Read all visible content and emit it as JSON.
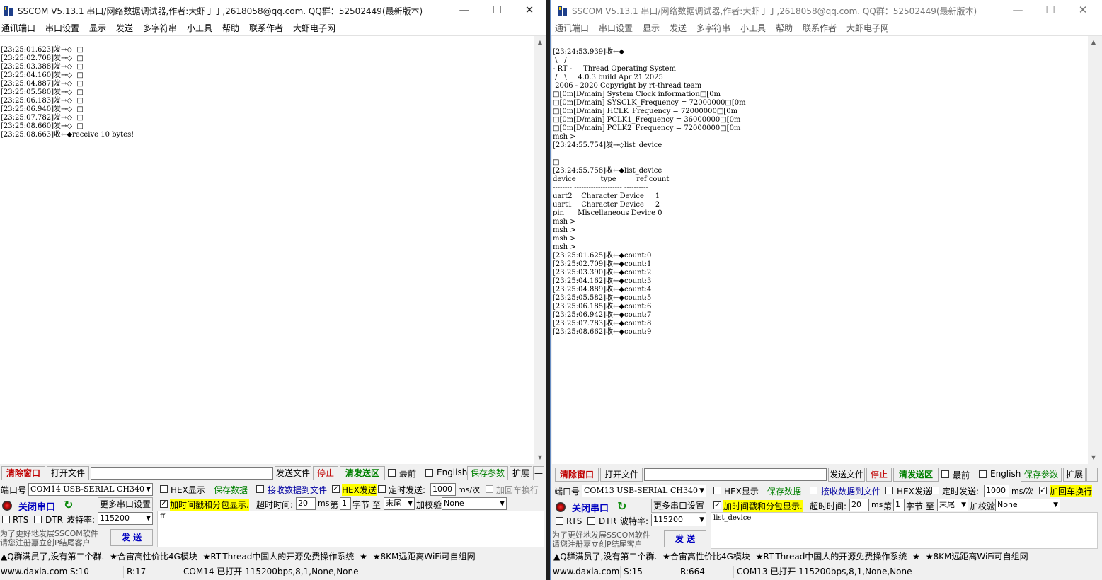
{
  "left": {
    "title": "SSCOM V5.13.1 串口/网络数据调试器,作者:大虾丁丁,2618058@qq.com. QQ群：52502449(最新版本)",
    "menu": [
      "通讯端口",
      "串口设置",
      "显示",
      "发送",
      "多字符串",
      "小工具",
      "帮助",
      "联系作者",
      "大虾电子网"
    ],
    "receive_lines": [
      "[23:25:01.623]发→◇  □",
      "[23:25:02.708]发→◇  □",
      "[23:25:03.388]发→◇  □",
      "[23:25:04.160]发→◇  □",
      "[23:25:04.887]发→◇  □",
      "[23:25:05.580]发→◇  □",
      "[23:25:06.183]发→◇  □",
      "[23:25:06.940]发→◇  □",
      "[23:25:07.782]发→◇  □",
      "[23:25:08.660]发→◇  □",
      "[23:25:08.663]收←◆receive 10 bytes!"
    ],
    "toolbar": {
      "clear": "清除窗口",
      "open_file": "打开文件",
      "file_path": "",
      "send_file": "发送文件",
      "stop": "停止",
      "clear_send": "清发送区",
      "topmost": "最前",
      "english": "English",
      "save_params": "保存参数",
      "expand": "扩展",
      "collapse": "—"
    },
    "port_label": "端口号",
    "port_value": "COM14 USB-SERIAL CH340",
    "hex_display": "HEX显示",
    "save_data": "保存数据",
    "recv_to_file": "接收数据到文件",
    "hex_send": "HEX发送",
    "hex_send_checked": "✓",
    "timed_send": "定时发送:",
    "timed_interval": "1000",
    "timed_unit": "ms/次",
    "add_crlf": "加回车换行",
    "close_port": "关闭串口",
    "more_settings": "更多串口设置",
    "timestamp_label": "加时间戳和分包显示.",
    "timeout_label": "超时时间:",
    "timeout_value": "20",
    "ms": "ms",
    "byte_prefix": "第",
    "byte_index": "1",
    "byte_label": "字节 至",
    "byte_end": "末尾",
    "checksum_label": "加校验",
    "checksum_value": "None",
    "rts": "RTS",
    "dtr": "DTR",
    "baud_label": "波特率:",
    "baud_value": "115200",
    "send_text": "ff",
    "send_btn": "发  送",
    "hint1": "为了更好地发展SSCOM软件",
    "hint2": "请您注册嘉立创P结尾客户",
    "promo": [
      "▲Q群满员了,没有第二个群.",
      "★合宙高性价比4G模块",
      "★RT-Thread中国人的开源免费操作系统",
      "★",
      "★8KM远距离WiFi可自组网"
    ],
    "status": {
      "site": "www.daxia.com",
      "sent": "S:10",
      "recv": "R:17",
      "port": "COM14 已打开  115200bps,8,1,None,None"
    }
  },
  "right": {
    "title": "SSCOM V5.13.1 串口/网络数据调试器,作者:大虾丁丁,2618058@qq.com. QQ群：52502449(最新版本)",
    "menu": [
      "通讯端口",
      "串口设置",
      "显示",
      "发送",
      "多字符串",
      "小工具",
      "帮助",
      "联系作者",
      "大虾电子网"
    ],
    "receive_lines": [
      "[23:24:53.939]收←◆",
      " \\ | /",
      "- RT -     Thread Operating System",
      " / | \\     4.0.3 build Apr 21 2025",
      " 2006 - 2020 Copyright by rt-thread team",
      "□[0m[D/main] System Clock information□[0m",
      "□[0m[D/main] SYSCLK_Frequency = 72000000□[0m",
      "□[0m[D/main] HCLK_Frequency = 72000000□[0m",
      "□[0m[D/main] PCLK1_Frequency = 36000000□[0m",
      "□[0m[D/main] PCLK2_Frequency = 72000000□[0m",
      "msh >",
      "[23:24:55.754]发→◇list_device",
      "",
      "□",
      "[23:24:55.758]收←◆list_device",
      "device           type         ref count",
      "-------- -------------------- ----------",
      "uart2    Character Device     1",
      "uart1    Character Device     2",
      "pin      Miscellaneous Device 0",
      "msh >",
      "msh >",
      "msh >",
      "msh >",
      "[23:25:01.625]收←◆count:0",
      "[23:25:02.709]收←◆count:1",
      "[23:25:03.390]收←◆count:2",
      "[23:25:04.162]收←◆count:3",
      "[23:25:04.889]收←◆count:4",
      "[23:25:05.582]收←◆count:5",
      "[23:25:06.185]收←◆count:6",
      "[23:25:06.942]收←◆count:7",
      "[23:25:07.783]收←◆count:8",
      "[23:25:08.662]收←◆count:9"
    ],
    "toolbar": {
      "clear": "清除窗口",
      "open_file": "打开文件",
      "file_path": "",
      "send_file": "发送文件",
      "stop": "停止",
      "clear_send": "清发送区",
      "topmost": "最前",
      "english": "English",
      "save_params": "保存参数",
      "expand": "扩展",
      "collapse": "—"
    },
    "port_label": "端口号",
    "port_value": "COM13 USB-SERIAL CH340",
    "hex_display": "HEX显示",
    "save_data": "保存数据",
    "recv_to_file": "接收数据到文件",
    "hex_send": "HEX发送",
    "hex_send_checked": "",
    "timed_send": "定时发送:",
    "timed_interval": "1000",
    "timed_unit": "ms/次",
    "add_crlf": "加回车换行",
    "close_port": "关闭串口",
    "more_settings": "更多串口设置",
    "timestamp_label": "加时间戳和分包显示.",
    "timeout_label": "超时时间:",
    "timeout_value": "20",
    "ms": "ms",
    "byte_prefix": "第",
    "byte_index": "1",
    "byte_label": "字节 至",
    "byte_end": "末尾",
    "checksum_label": "加校验",
    "checksum_value": "None",
    "rts": "RTS",
    "dtr": "DTR",
    "baud_label": "波特率:",
    "baud_value": "115200",
    "send_text": "list_device",
    "send_btn": "发  送",
    "hint1": "为了更好地发展SSCOM软件",
    "hint2": "请您注册嘉立创P结尾客户",
    "promo": [
      "▲Q群满员了,没有第二个群.",
      "★合宙高性价比4G模块",
      "★RT-Thread中国人的开源免费操作系统",
      "★",
      "★8KM远距离WiFi可自组网"
    ],
    "status": {
      "site": "www.daxia.com",
      "sent": "S:15",
      "recv": "R:664",
      "port": "COM13 已打开  115200bps,8,1,None,None"
    }
  },
  "window_controls": {
    "minimize": "—",
    "maximize": "☐",
    "close": "✕"
  },
  "colors": {
    "accent_red": "#c00000",
    "accent_green": "#008000",
    "highlight_yellow": "#ffff00",
    "title_icon_blue": "#1e3f8a"
  }
}
